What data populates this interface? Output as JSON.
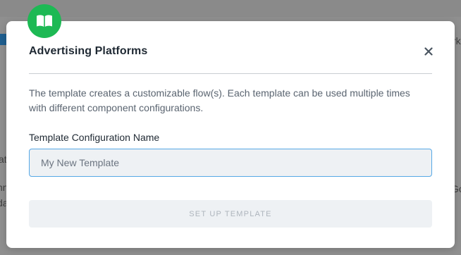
{
  "background": {
    "left_text_1": "at",
    "left_text_2": "nn",
    "left_text_3": "da",
    "right_text_1": "rk",
    "right_text_2": "Go"
  },
  "modal": {
    "badge_icon": "book-open-icon",
    "title": "Advertising Platforms",
    "close_icon": "close-icon",
    "description": "The template creates a customizable flow(s). Each template can be used multiple times with different component configurations.",
    "field_label": "Template Configuration Name",
    "input": {
      "value": "",
      "placeholder": "My New Template"
    },
    "submit_label": "SET UP TEMPLATE"
  },
  "colors": {
    "badge_green": "#1db954",
    "input_focus_border": "#56a8e6",
    "button_disabled_bg": "#eef1f4",
    "button_disabled_text": "#aeb5bd"
  }
}
